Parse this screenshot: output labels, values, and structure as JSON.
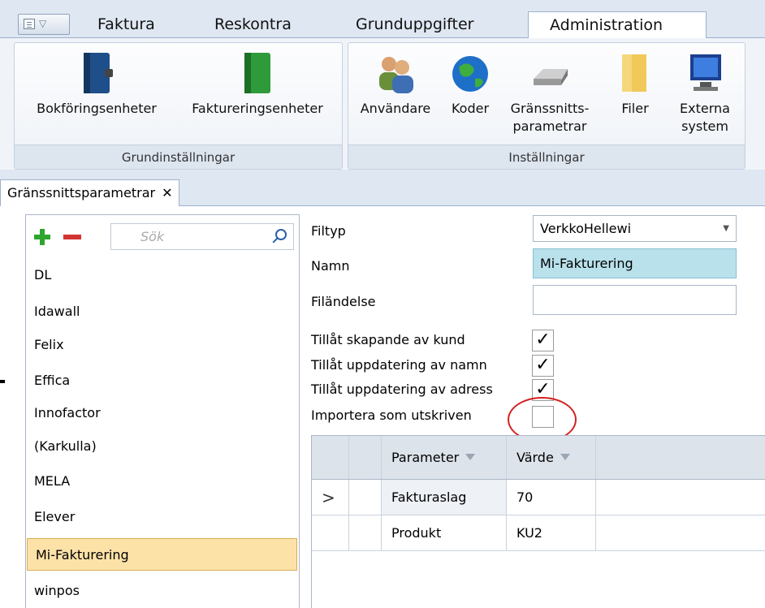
{
  "top_tabs": [
    "Faktura",
    "Reskontra",
    "Grunduppgifter",
    "Administration"
  ],
  "ribbon": {
    "group1": {
      "caption": "Grundinställningar",
      "buttons": [
        "Bokföringsenheter",
        "Faktureringsenheter"
      ]
    },
    "group2": {
      "caption": "Inställningar",
      "buttons": [
        "Användare",
        "Koder",
        "Gränssnitts-",
        "parametrar",
        "Filer",
        "Externa",
        "system"
      ]
    }
  },
  "doc_tab": {
    "label": "Gränssnittsparametrar",
    "close": "✕"
  },
  "left_panel": {
    "search_placeholder": "Sök",
    "items": [
      "DL",
      "Idawall",
      "Felix",
      "Effica",
      "Innofactor",
      "(Karkulla)",
      "MELA",
      "Elever",
      "Mi-Fakturering",
      "winpos"
    ],
    "selected": "Mi-Fakturering"
  },
  "form": {
    "filtyp_label": "Filtyp",
    "filtyp_value": "VerkkoHellewi",
    "namn_label": "Namn",
    "namn_value": "Mi-Fakturering",
    "filandelse_label": "Filändelse",
    "filandelse_value": "",
    "checks": [
      {
        "label": "Tillåt skapande av kund",
        "checked": true
      },
      {
        "label": "Tillåt uppdatering av namn",
        "checked": true
      },
      {
        "label": "Tillåt uppdatering av adress",
        "checked": true
      },
      {
        "label": "Importera som utskriven",
        "checked": false
      }
    ],
    "check_mark": "✓"
  },
  "grid": {
    "headers": [
      "Parameter",
      "Värde"
    ],
    "rows": [
      {
        "indicator": ">",
        "parameter": "Fakturaslag",
        "value": "70"
      },
      {
        "indicator": "",
        "parameter": "Produkt",
        "value": "KU2"
      }
    ]
  },
  "colors": {
    "selected_item": "#fde2a8",
    "name_field": "#b9e1ec",
    "highlight_circle": "#d42020"
  }
}
